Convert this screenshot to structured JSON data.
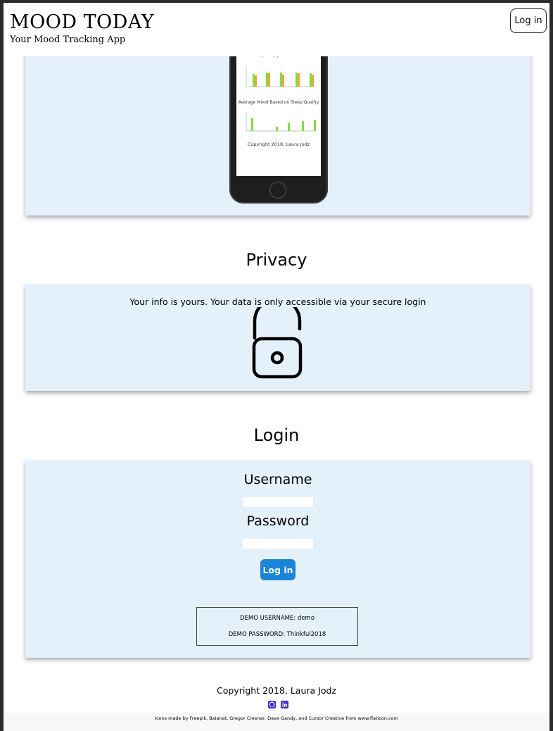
{
  "header": {
    "title": "MOOD TODAY",
    "subtitle": "Your Mood Tracking App",
    "login_label": "Log in"
  },
  "phone_preview": {
    "chart1_title": "Average Sleep Quality & Healthy Eating Quality per Mood",
    "chart2_title": "Average Mood Based on Sleep Quality",
    "copyright": "Copyright 2018, Laura Jodz"
  },
  "privacy": {
    "heading": "Privacy",
    "text": "Your info is yours. Your data is only accessible via your secure login",
    "icon": "unlocked-padlock-icon"
  },
  "login": {
    "heading": "Login",
    "username_label": "Username",
    "username_value": "",
    "password_label": "Password",
    "password_value": "",
    "button_label": "Log in",
    "demo_username": "DEMO USERNAME: demo",
    "demo_password": "DEMO PASSWORD: Thinkful2018"
  },
  "footer": {
    "copyright": "Copyright 2018, Laura Jodz",
    "github_icon": "github-icon",
    "linkedin_icon": "linkedin-icon",
    "credits": "Icons made by Freepik, Baianat, Gregor Cresnar, Dave Gandy, and Cursor Creative from www.flaticon.com"
  },
  "colors": {
    "panel_bg": "#e4f1fb",
    "button_blue": "#1a84d6",
    "social_purple": "#3a2fd6",
    "bar_green": "#7ee040",
    "bar_orange": "#f4a33c"
  }
}
